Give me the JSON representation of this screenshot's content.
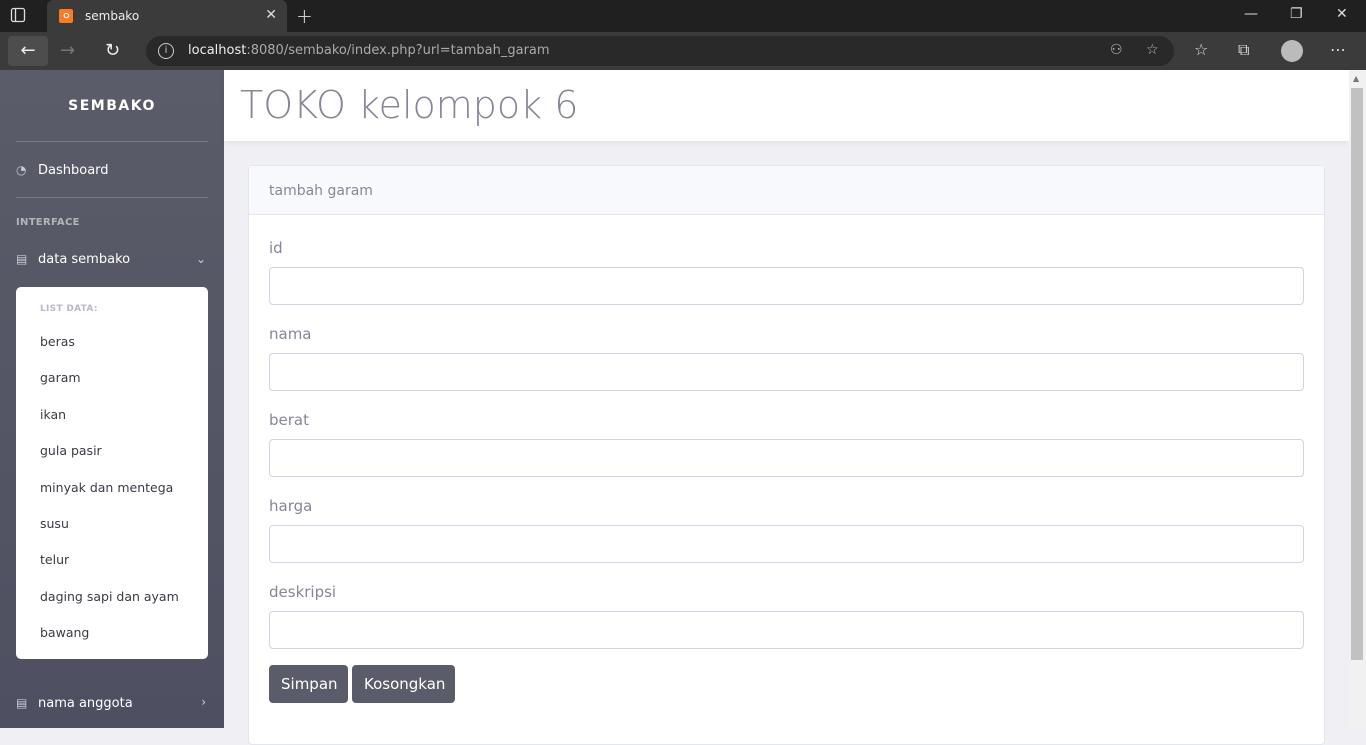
{
  "browser": {
    "tab_title": "sembako",
    "url_host": "localhost",
    "url_rest": ":8080/sembako/index.php?url=tambah_garam"
  },
  "sidebar": {
    "brand": "SEMBAKO",
    "dashboard": "Dashboard",
    "heading": "INTERFACE",
    "data_menu": "data sembako",
    "list_heading": "LIST DATA:",
    "items": [
      "beras",
      "garam",
      "ikan",
      "gula pasir",
      "minyak dan mentega",
      "susu",
      "telur",
      "daging sapi dan ayam",
      "bawang"
    ],
    "members": "nama anggota"
  },
  "header": {
    "title": "TOKO kelompok 6"
  },
  "form": {
    "title": "tambah garam",
    "fields": [
      {
        "label": "id",
        "value": ""
      },
      {
        "label": "nama",
        "value": ""
      },
      {
        "label": "berat",
        "value": ""
      },
      {
        "label": "harga",
        "value": ""
      },
      {
        "label": "deskripsi",
        "value": ""
      }
    ],
    "save_label": "Simpan",
    "reset_label": "Kosongkan"
  },
  "colors": {
    "sidebar": "#5a5c69",
    "button": "#5a5c69",
    "text_muted": "#858796"
  }
}
